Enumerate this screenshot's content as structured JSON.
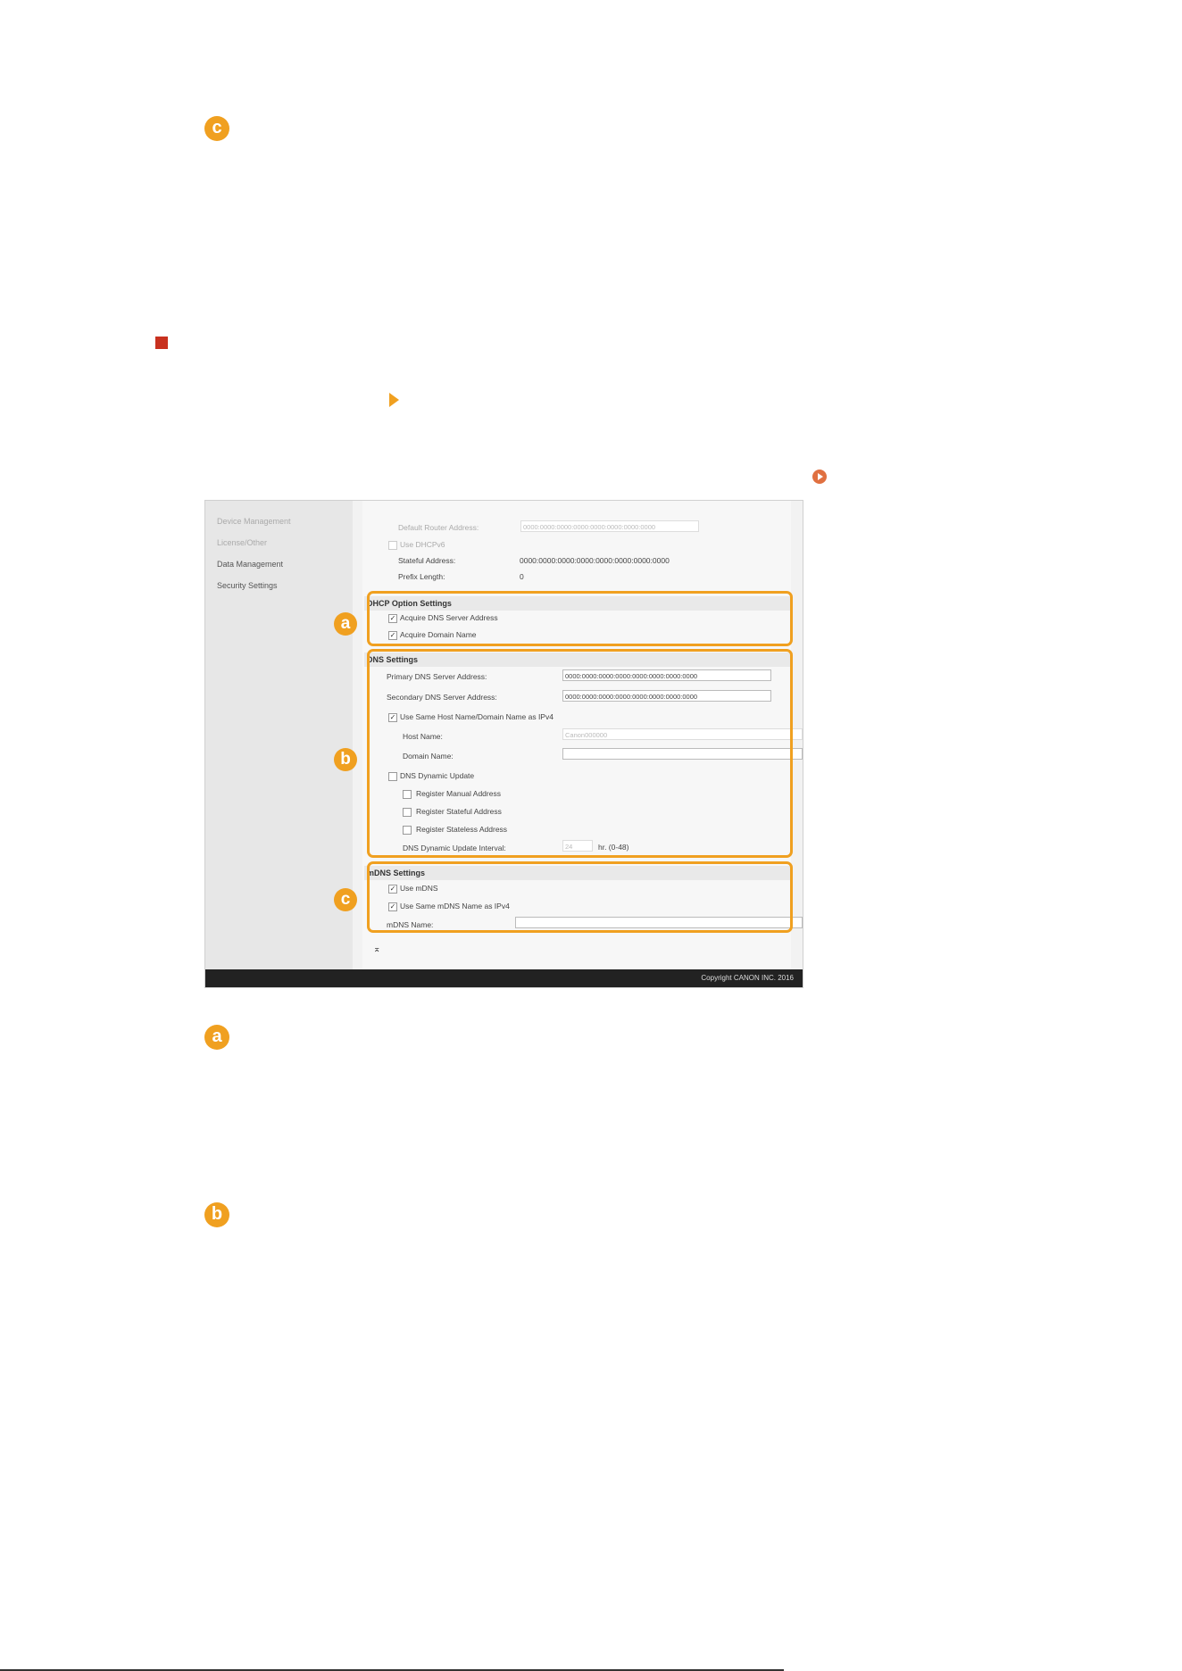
{
  "badges": {
    "a": "a",
    "b": "b",
    "c": "c"
  },
  "screenshot": {
    "sidebar": [
      {
        "label": "Device Management",
        "faded": true
      },
      {
        "label": "License/Other",
        "faded": true
      },
      {
        "label": "Data Management",
        "faded": false
      },
      {
        "label": "Security Settings",
        "faded": false
      }
    ],
    "ipv6": {
      "default_router_label": "Default Router Address:",
      "default_router_value": "0000:0000:0000:0000:0000:0000:0000:0000",
      "use_dhcpv6": "Use DHCPv6",
      "stateful_label": "Stateful Address:",
      "stateful_value": "0000:0000:0000:0000:0000:0000:0000:0000",
      "prefix_label": "Prefix Length:",
      "prefix_value": "0"
    },
    "dhcp": {
      "title": "DHCP Option Settings",
      "acquire_dns": "Acquire DNS Server Address",
      "acquire_domain": "Acquire Domain Name"
    },
    "dns": {
      "title": "DNS Settings",
      "primary_label": "Primary DNS Server Address:",
      "primary_value": "0000:0000:0000:0000:0000:0000:0000:0000",
      "secondary_label": "Secondary DNS Server Address:",
      "secondary_value": "0000:0000:0000:0000:0000:0000:0000:0000",
      "use_same": "Use Same Host Name/Domain Name as IPv4",
      "host_label": "Host Name:",
      "host_value": "Canon000000",
      "domain_label": "Domain Name:",
      "domain_value": "",
      "dynamic": "DNS Dynamic Update",
      "reg_manual": "Register Manual Address",
      "reg_stateful": "Register Stateful Address",
      "reg_stateless": "Register Stateless Address",
      "interval_label": "DNS Dynamic Update Interval:",
      "interval_value": "24",
      "interval_unit": "hr. (0-48)"
    },
    "mdns": {
      "title": "mDNS Settings",
      "use_mdns": "Use mDNS",
      "use_same": "Use Same mDNS Name as IPv4",
      "name_label": "mDNS Name:",
      "name_value": ""
    },
    "top_link": "⌅",
    "copyright": "Copyright CANON INC. 2016"
  }
}
